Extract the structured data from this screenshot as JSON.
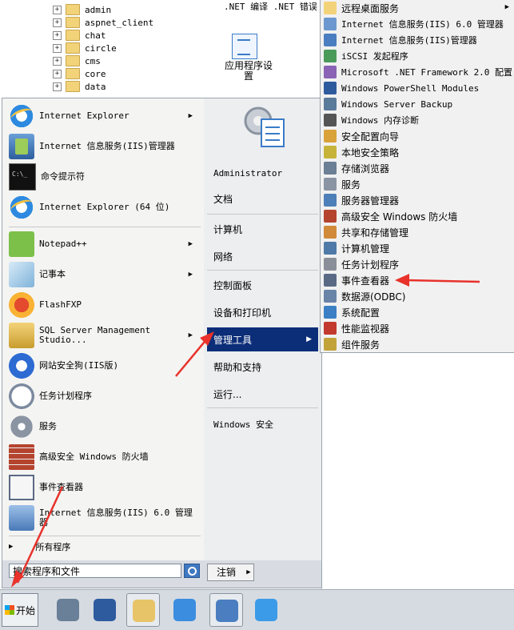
{
  "tree": {
    "folders": [
      "admin",
      "aspnet_client",
      "chat",
      "circle",
      "cms",
      "core",
      "data"
    ]
  },
  "iis_pane": {
    "top_text": ".NET 编译  .NET 错误",
    "feature_label": "应用程序设置"
  },
  "start_menu": {
    "left_items": [
      {
        "label": "Internet Explorer",
        "icon": "internet-explorer-icon",
        "submenu": true
      },
      {
        "label": "Internet 信息服务(IIS)管理器",
        "icon": "iis-manager-icon",
        "submenu": false
      },
      {
        "label": "命令提示符",
        "icon": "command-prompt-icon",
        "submenu": false
      },
      {
        "label": "Internet Explorer (64 位)",
        "icon": "internet-explorer-icon",
        "submenu": false
      },
      {
        "label": "Notepad++",
        "icon": "notepad-plus-plus-icon",
        "submenu": true
      },
      {
        "label": "记事本",
        "icon": "notepad-icon",
        "submenu": true
      },
      {
        "label": "FlashFXP",
        "icon": "flashfxp-icon",
        "submenu": false
      },
      {
        "label": "SQL Server Management Studio...",
        "icon": "sql-server-icon",
        "submenu": true
      },
      {
        "label": "网站安全狗(IIS版)",
        "icon": "safedog-icon",
        "submenu": false
      },
      {
        "label": "任务计划程序",
        "icon": "task-scheduler-icon",
        "submenu": false
      },
      {
        "label": "服务",
        "icon": "services-icon",
        "submenu": false
      },
      {
        "label": "高级安全 Windows 防火墙",
        "icon": "firewall-icon",
        "submenu": false
      },
      {
        "label": "事件查看器",
        "icon": "event-viewer-icon",
        "submenu": false
      },
      {
        "label": "Internet 信息服务(IIS) 6.0 管理器",
        "icon": "iis6-manager-icon",
        "submenu": false
      }
    ],
    "all_programs": "所有程序",
    "search_placeholder": "搜索程序和文件",
    "right_items": [
      {
        "label": "Administrator",
        "mono": true
      },
      {
        "label": "文档"
      },
      {
        "label": "计算机"
      },
      {
        "label": "网络"
      },
      {
        "label": "控制面板"
      },
      {
        "label": "设备和打印机"
      },
      {
        "label": "管理工具",
        "active": true,
        "submenu": true
      },
      {
        "label": "帮助和支持"
      },
      {
        "label": "运行..."
      },
      {
        "label": "Windows 安全",
        "mono": true
      }
    ],
    "logoff_label": "注销"
  },
  "admin_tools": [
    {
      "label": "远程桌面服务",
      "icon": "folder-icon",
      "submenu": true
    },
    {
      "label": "Internet 信息服务(IIS) 6.0 管理器",
      "icon": "iis6-manager-icon"
    },
    {
      "label": "Internet 信息服务(IIS)管理器",
      "icon": "iis-manager-icon"
    },
    {
      "label": "iSCSI 发起程序",
      "icon": "iscsi-icon"
    },
    {
      "label": "Microsoft .NET Framework 2.0 配置",
      "icon": "dotnet-config-icon"
    },
    {
      "label": "Windows PowerShell Modules",
      "icon": "powershell-icon"
    },
    {
      "label": "Windows Server Backup",
      "icon": "server-backup-icon"
    },
    {
      "label": "Windows 内存诊断",
      "icon": "memory-diagnostic-icon"
    },
    {
      "label": "安全配置向导",
      "icon": "security-wizard-icon"
    },
    {
      "label": "本地安全策略",
      "icon": "local-security-policy-icon"
    },
    {
      "label": "存储浏览器",
      "icon": "storage-explorer-icon"
    },
    {
      "label": "服务",
      "icon": "services-icon"
    },
    {
      "label": "服务器管理器",
      "icon": "server-manager-icon"
    },
    {
      "label": "高级安全 Windows 防火墙",
      "icon": "firewall-icon"
    },
    {
      "label": "共享和存储管理",
      "icon": "share-storage-icon"
    },
    {
      "label": "计算机管理",
      "icon": "computer-management-icon"
    },
    {
      "label": "任务计划程序",
      "icon": "task-scheduler-icon"
    },
    {
      "label": "事件查看器",
      "icon": "event-viewer-icon"
    },
    {
      "label": "数据源(ODBC)",
      "icon": "odbc-icon"
    },
    {
      "label": "系统配置",
      "icon": "system-config-icon"
    },
    {
      "label": "性能监视器",
      "icon": "performance-monitor-icon"
    },
    {
      "label": "组件服务",
      "icon": "component-services-icon"
    }
  ],
  "taskbar": {
    "start_label": "开始",
    "buttons": [
      "server-manager-icon",
      "powershell-icon",
      "file-explorer-icon",
      "cloud-sync-icon",
      "iis-manager-icon",
      "baidu-netdisk-icon"
    ]
  },
  "colors": {
    "active_highlight": "#0c2e78",
    "annotation_red": "#e8322b"
  }
}
